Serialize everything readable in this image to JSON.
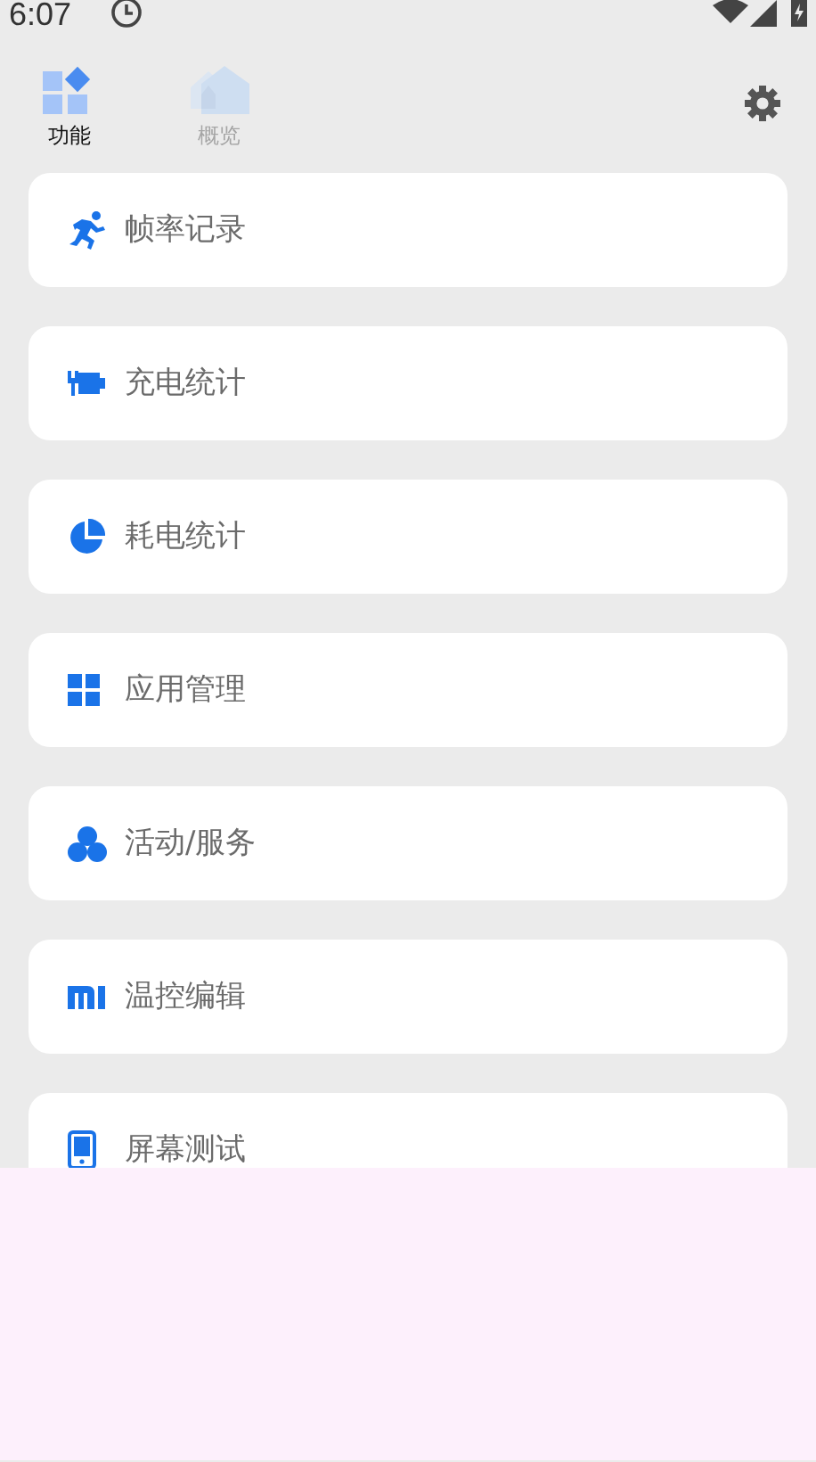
{
  "status_bar": {
    "time": "6:07"
  },
  "tabs": [
    {
      "label": "功能",
      "selected": true
    },
    {
      "label": "概览",
      "selected": false
    }
  ],
  "items": [
    {
      "label": "帧率记录"
    },
    {
      "label": "充电统计"
    },
    {
      "label": "耗电统计"
    },
    {
      "label": "应用管理"
    },
    {
      "label": "活动/服务"
    },
    {
      "label": "温控编辑"
    },
    {
      "label": "屏幕测试"
    }
  ]
}
